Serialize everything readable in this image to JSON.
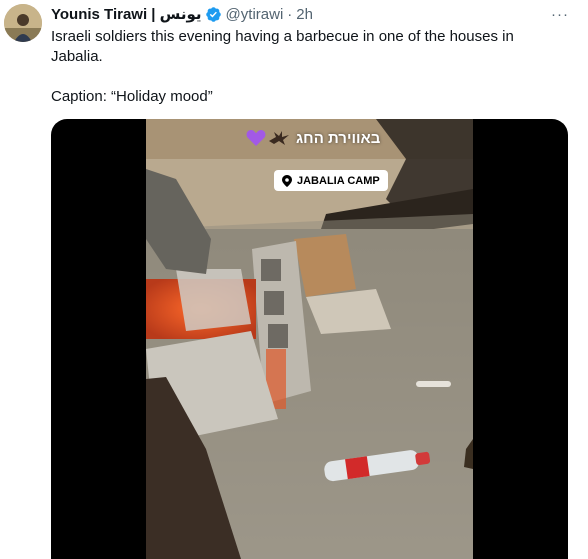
{
  "author": {
    "display_name": "Younis Tirawi | يونس",
    "handle": "@ytirawi",
    "separator": "·",
    "time": "2h",
    "verified_icon": "verified-badge-icon"
  },
  "menu": {
    "icon": "more-horizontal-icon",
    "label": "···"
  },
  "tweet": {
    "line1": "Israeli soldiers this evening having a barbecue in one of the houses in",
    "line2": "Jabalia.",
    "line3": "Caption: “Holiday mood”"
  },
  "media": {
    "overlay_text": "באווירת החג",
    "location_label": "JABALIA CAMP",
    "icons": [
      "purple-heart-icon",
      "eagle-icon",
      "location-pin-icon"
    ]
  },
  "colors": {
    "text_primary": "#0f1419",
    "text_secondary": "#536471",
    "verified": "#1d9bf0",
    "media_bg": "#000000",
    "heart": "#a259e6"
  }
}
